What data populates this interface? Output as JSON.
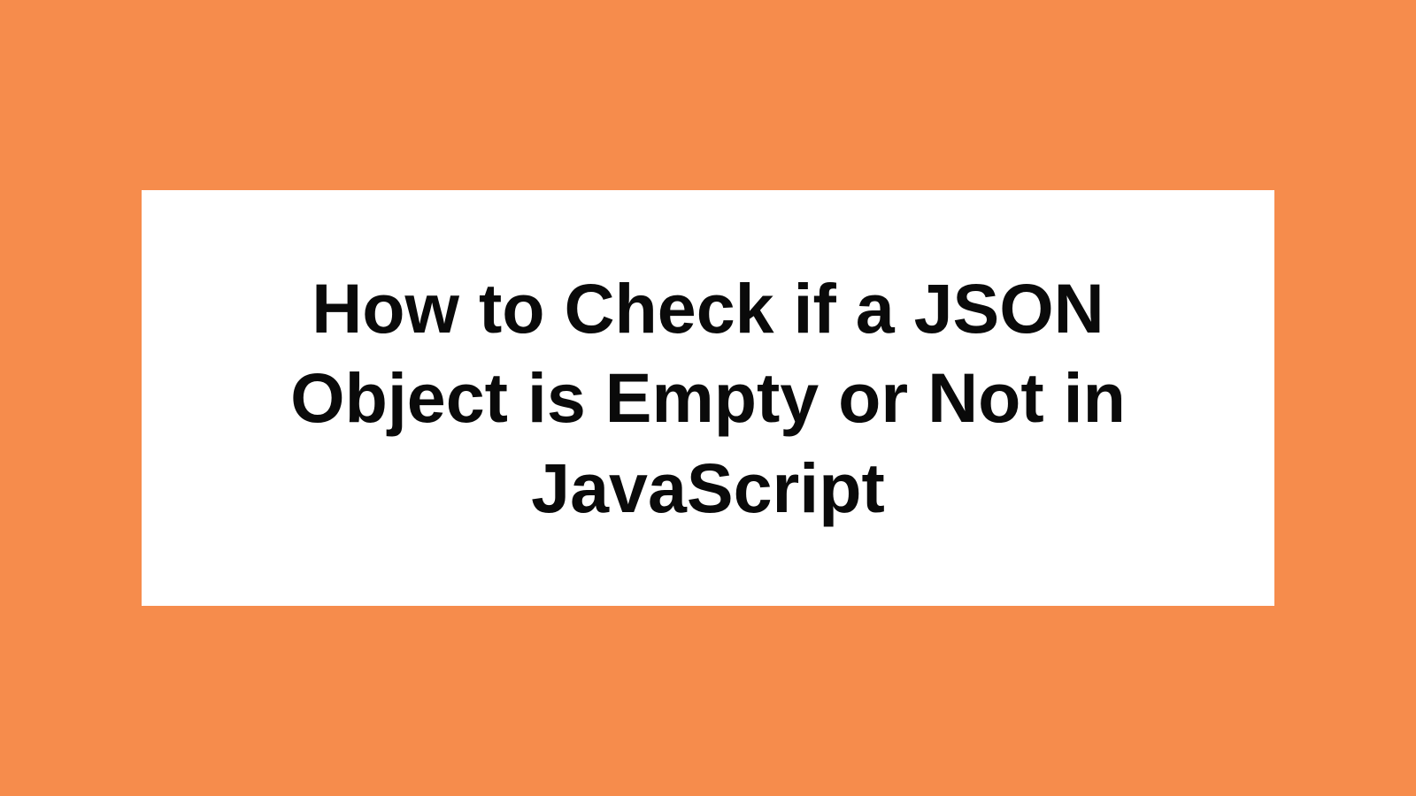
{
  "card": {
    "title": "How to Check if a JSON Object is Empty or Not in JavaScript"
  },
  "colors": {
    "background": "#f68c4c",
    "card_bg": "#ffffff",
    "text": "#0a0a0a"
  }
}
